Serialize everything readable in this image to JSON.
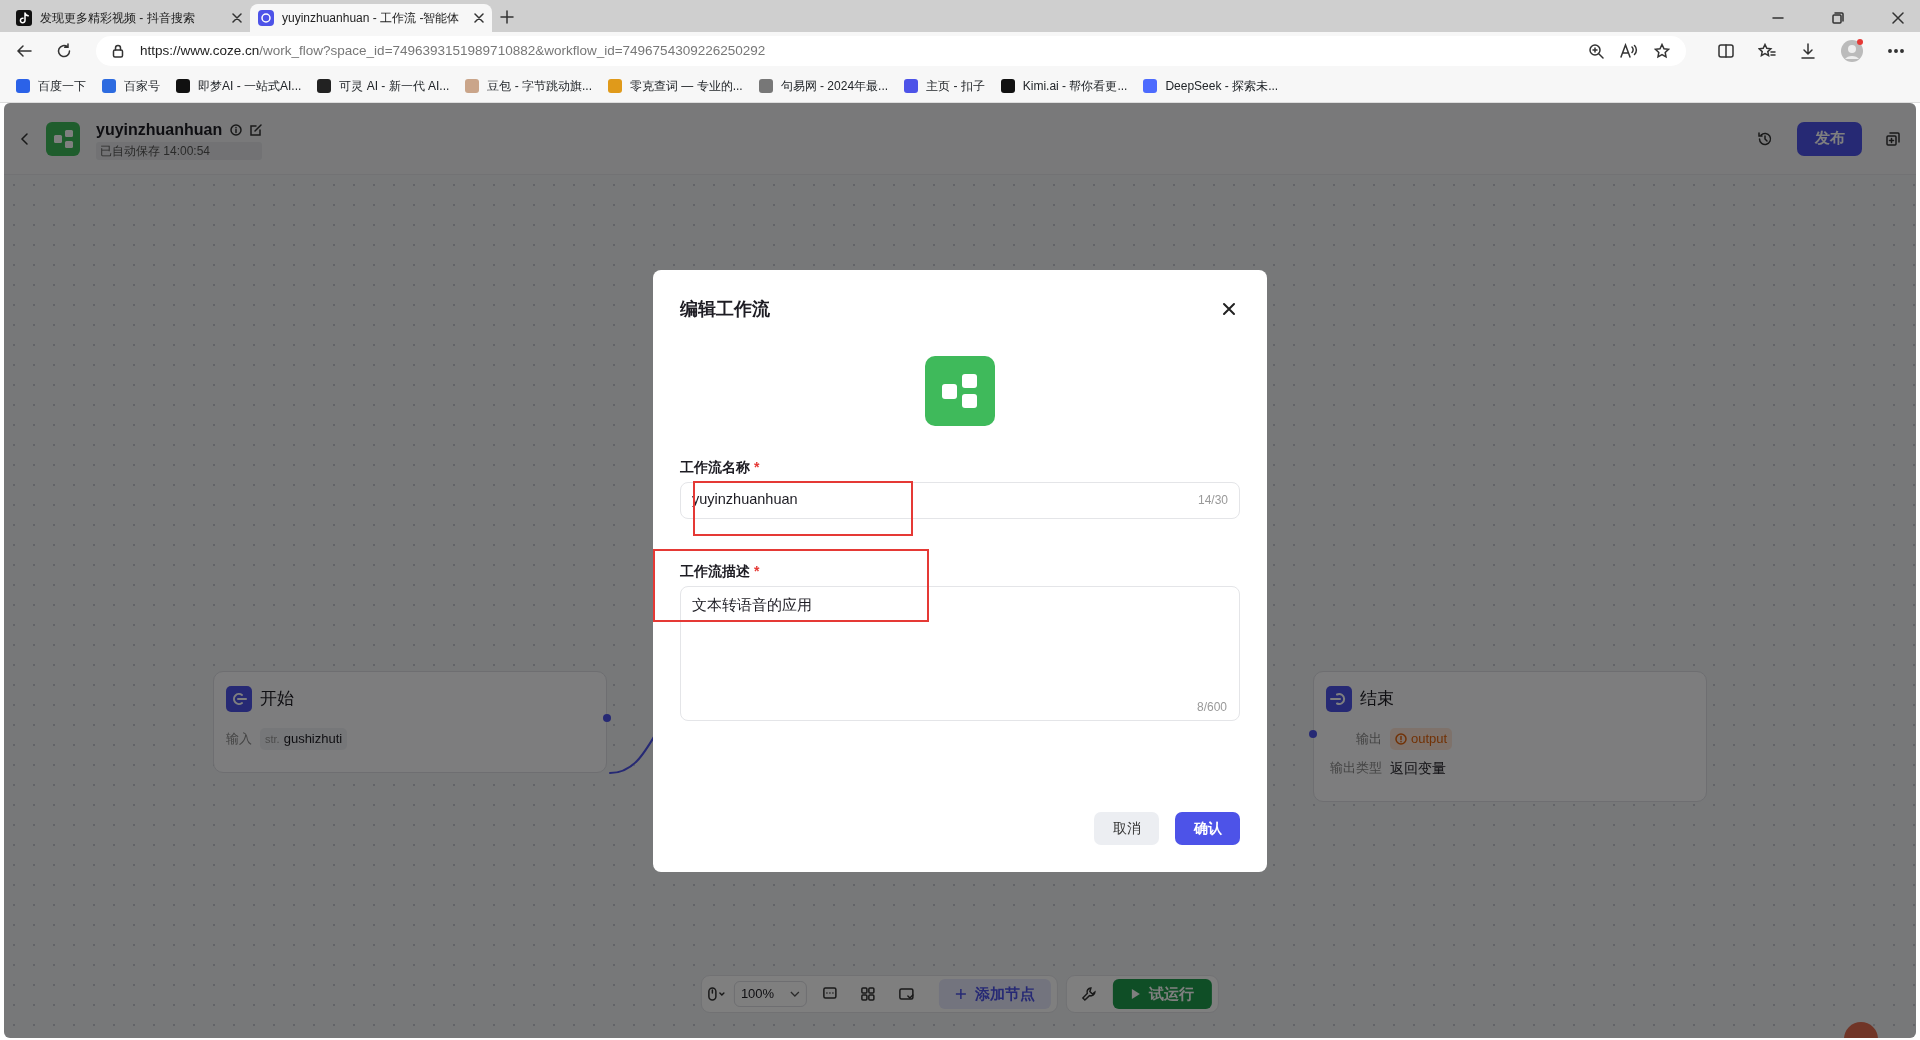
{
  "browser": {
    "tabs": [
      {
        "title": "发现更多精彩视频 - 抖音搜索",
        "selected": false,
        "kind": "douyin"
      },
      {
        "title": "yuyinzhuanhuan - 工作流 -智能体",
        "selected": true,
        "kind": "coze"
      }
    ],
    "url_host": "https://www.coze.cn",
    "url_path": "/work_flow?space_id=7496393151989710882&workflow_id=7496754309226250292",
    "bookmarks": [
      {
        "title": "百度一下",
        "color": "#2b62e8"
      },
      {
        "title": "百家号",
        "color": "#2d6be0"
      },
      {
        "title": "即梦AI - 一站式AI...",
        "color": "#111111"
      },
      {
        "title": "可灵 AI - 新一代 AI...",
        "color": "#222222"
      },
      {
        "title": "豆包 - 字节跳动旗...",
        "color": "#caa58a"
      },
      {
        "title": "零克查词 — 专业的...",
        "color": "#e09a1a"
      },
      {
        "title": "句易网 - 2024年最...",
        "color": "#777777"
      },
      {
        "title": "主页 - 扣子",
        "color": "#4d53e8"
      },
      {
        "title": "Kimi.ai - 帮你看更...",
        "color": "#111111"
      },
      {
        "title": "DeepSeek - 探索未...",
        "color": "#4d6bfe"
      }
    ]
  },
  "app": {
    "title": "yuyinzhuanhuan",
    "saved": "已自动保存 14:00:54",
    "publish": "发布"
  },
  "nodes": [
    {
      "kind": "start",
      "title": "开始",
      "rows": [
        {
          "label": "输入",
          "type": "str.",
          "value": "gushizhuti"
        }
      ]
    },
    {
      "kind": "end",
      "title": "结束",
      "rows": [
        {
          "label": "输出",
          "value": "output",
          "warning": true
        },
        {
          "label": "输出类型",
          "value": "返回变量"
        }
      ]
    }
  ],
  "toolbar": {
    "zoom": "100%",
    "add_node": "添加节点",
    "run": "试运行"
  },
  "dialog": {
    "title": "编辑工作流",
    "fields": [
      {
        "kind": "input",
        "label": "工作流名称",
        "required_mark": "*",
        "value": "yuyinzhuanhuan",
        "counter": "14/30",
        "highlighted": true
      },
      {
        "kind": "textarea",
        "label": "工作流描述",
        "required_mark": "*",
        "value": "文本转语音的应用",
        "counter": "8/600",
        "highlighted": true
      }
    ],
    "cancel": "取消",
    "confirm": "确认"
  }
}
